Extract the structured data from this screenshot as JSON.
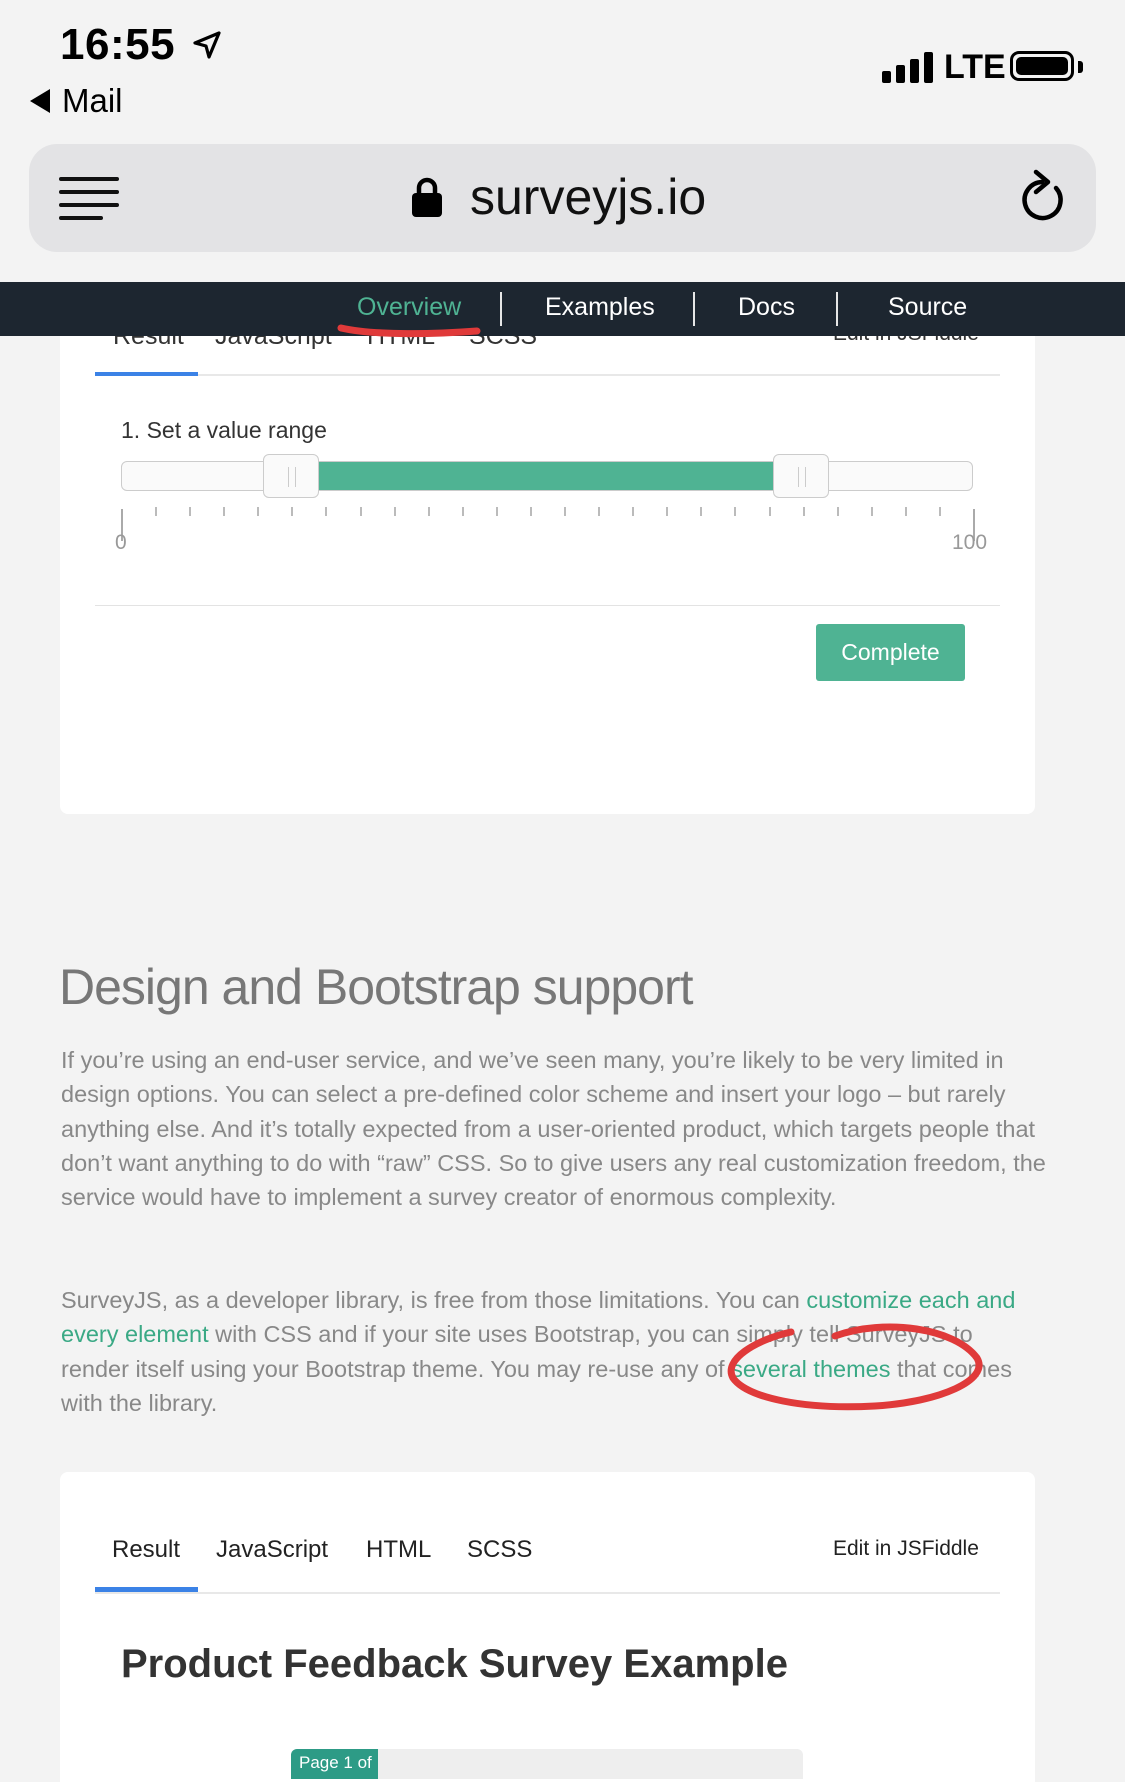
{
  "status_bar": {
    "time": "16:55",
    "back_label": "Mail",
    "network": "LTE"
  },
  "browser": {
    "url": "surveyjs.io"
  },
  "site_nav": {
    "items": [
      "Overview",
      "Examples",
      "Docs",
      "Source"
    ],
    "active": "Overview",
    "accent_color": "#4fb393"
  },
  "card1": {
    "tabs_partial": [
      "Result",
      "JavaScript",
      "HTML",
      "SCSS",
      "Edit in JSFiddle"
    ],
    "question_title": "1. Set a value range",
    "range_slider": {
      "min_label": "0",
      "max_label": "100",
      "low_value": 20,
      "high_value": 80,
      "fill_color": "#4fb393"
    },
    "complete_button": "Complete"
  },
  "article": {
    "heading": "Design and Bootstrap support",
    "para1": "If you’re using an end-user service, and we’ve seen many, you’re likely to be very limited in design options. You can select a pre-defined color scheme and insert your logo – but rarely anything else. And it’s totally expected from a user-oriented product, which targets people that don’t want anything to do with “raw” CSS. So to give users any real customization freedom, the service would have to implement a survey creator of enormous complexity.",
    "para2_part1": "SurveyJS, as a developer library, is free from those limitations. You can ",
    "para2_link1": "customize each and every element",
    "para2_part2": " with CSS and if your site uses Bootstrap, you can simply tell SurveyJS to render itself using your Bootstrap theme. You may re-use any of ",
    "para2_link2": "several themes",
    "para2_part3": " that comes with the library."
  },
  "card2": {
    "tabs": [
      "Result",
      "JavaScript",
      "HTML",
      "SCSS"
    ],
    "active_tab": "Result",
    "edit_link": "Edit in JSFiddle",
    "survey_title": "Product Feedback Survey Example",
    "progress_text": "Page 1 of",
    "progress_fraction": 0.17
  }
}
